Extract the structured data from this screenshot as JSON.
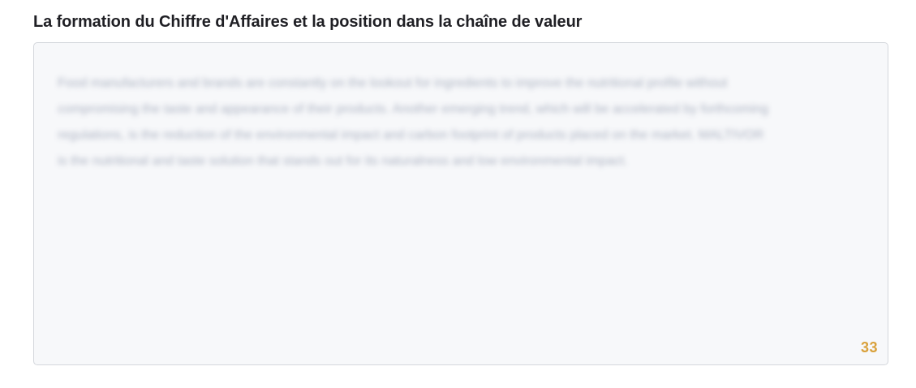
{
  "field": {
    "label": "La formation du Chiffre d'Affaires et la position dans la chaîne de valeur",
    "value": "Food manufacturers and brands are constantly on the lookout for ingredients to improve the nutritional profile without compromising the taste and appearance of their products. Another emerging trend, which will be accelerated by forthcoming regulations, is the reduction of the environmental impact and carbon footprint of products placed on the market. MALTIVOR is the nutritional and taste solution that stands out for its naturalness and low environmental impact.",
    "counter": "33"
  },
  "colors": {
    "counter": "#d9a13b",
    "field_background": "#f7f8fa",
    "field_border": "#d4d7dc"
  }
}
